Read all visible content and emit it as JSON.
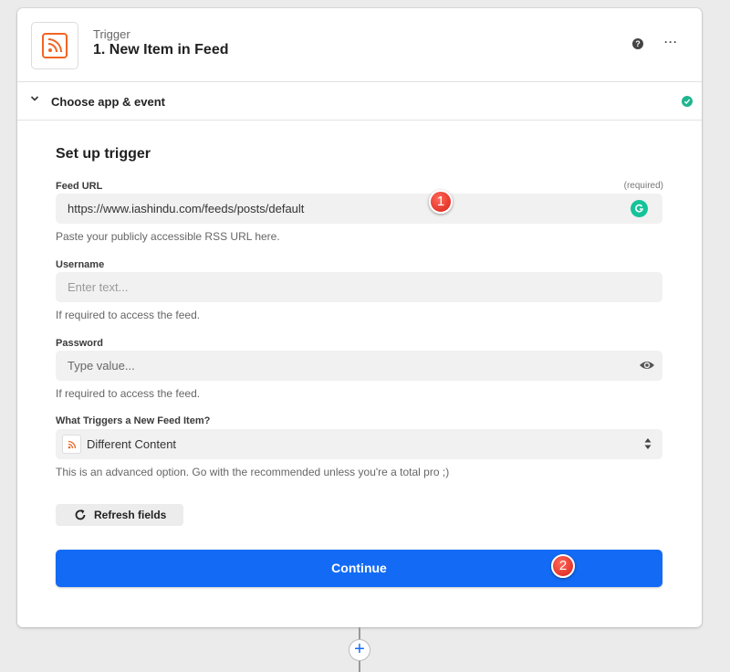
{
  "step": {
    "kind": "Trigger",
    "title": "1. New Item in Feed",
    "icon": "rss-icon",
    "accent_color": "#f26522"
  },
  "header_actions": {
    "help": "?",
    "more": "···"
  },
  "section": {
    "label": "Choose app & event",
    "status_color": "#1fb58e"
  },
  "form": {
    "title": "Set up trigger",
    "feed_url": {
      "label": "Feed URL",
      "required": "(required)",
      "value": "https://www.iashindu.com/feeds/posts/default",
      "hint": "Paste your publicly accessible RSS URL here."
    },
    "username": {
      "label": "Username",
      "placeholder": "Enter text...",
      "hint": "If required to access the feed."
    },
    "password": {
      "label": "Password",
      "placeholder": "Type value...",
      "hint": "If required to access the feed."
    },
    "trigger_type": {
      "label": "What Triggers a New Feed Item?",
      "value": "Different Content",
      "hint": "This is an advanced option. Go with the recommended unless you're a total pro ;)"
    },
    "refresh_label": "Refresh fields",
    "continue_label": "Continue",
    "primary_color": "#136bf5"
  },
  "annotations": {
    "badge_1": "1",
    "badge_2": "2"
  },
  "add_step": "+"
}
